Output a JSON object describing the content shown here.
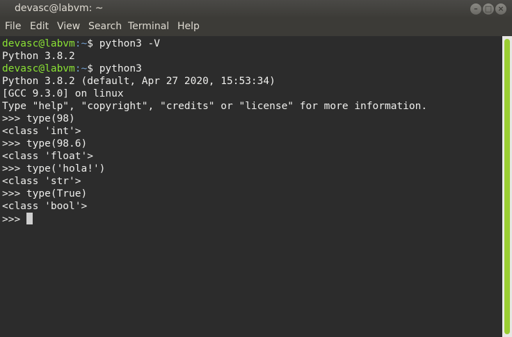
{
  "window": {
    "title": "devasc@labvm: ~",
    "controls": {
      "minimize": "–",
      "maximize": "□",
      "close": "×"
    }
  },
  "menu": [
    "File",
    "Edit",
    "View",
    "Search",
    "Terminal",
    "Help"
  ],
  "terminal": {
    "prompt_user": "devasc@labvm",
    "prompt_path": ":~",
    "lines": [
      {
        "type": "prompt",
        "cmd": "$ python3 -V"
      },
      {
        "type": "out",
        "text": "Python 3.8.2"
      },
      {
        "type": "prompt",
        "cmd": "$ python3"
      },
      {
        "type": "out",
        "text": "Python 3.8.2 (default, Apr 27 2020, 15:53:34)"
      },
      {
        "type": "out",
        "text": "[GCC 9.3.0] on linux"
      },
      {
        "type": "out",
        "text": "Type \"help\", \"copyright\", \"credits\" or \"license\" for more information."
      },
      {
        "type": "out",
        "text": ">>> type(98)"
      },
      {
        "type": "out",
        "text": "<class 'int'>"
      },
      {
        "type": "out",
        "text": ">>> type(98.6)"
      },
      {
        "type": "out",
        "text": "<class 'float'>"
      },
      {
        "type": "out",
        "text": ">>> type('hola!')"
      },
      {
        "type": "out",
        "text": "<class 'str'>"
      },
      {
        "type": "out",
        "text": ">>> type(True)"
      },
      {
        "type": "out",
        "text": "<class 'bool'>"
      }
    ],
    "current_prompt": ">>> "
  },
  "colors": {
    "user": "#8ae234",
    "path": "#729fcf",
    "scroll_thumb": "#9acd32"
  }
}
